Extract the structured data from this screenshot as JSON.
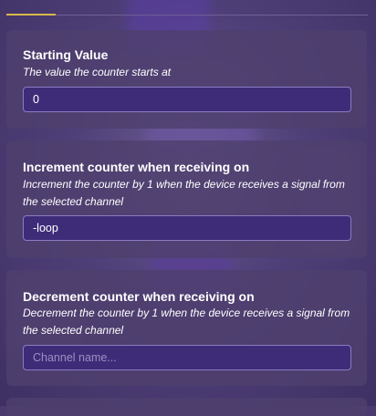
{
  "settings": [
    {
      "title": "Starting Value",
      "description": "The value the counter starts at",
      "value": "0",
      "placeholder": ""
    },
    {
      "title": "Increment counter when receiving on",
      "description": "Increment the counter by 1 when the device receives a signal from the selected channel",
      "value": "-loop",
      "placeholder": ""
    },
    {
      "title": "Decrement counter when receiving on",
      "description": "Decrement the counter by 1 when the device receives a signal from the selected channel",
      "value": "",
      "placeholder": "Channel name..."
    }
  ],
  "colors": {
    "accent": "#d9b84a",
    "field_bg": "#3f2c79",
    "field_border": "#8a7cc2",
    "card_bg": "#4e406e"
  }
}
